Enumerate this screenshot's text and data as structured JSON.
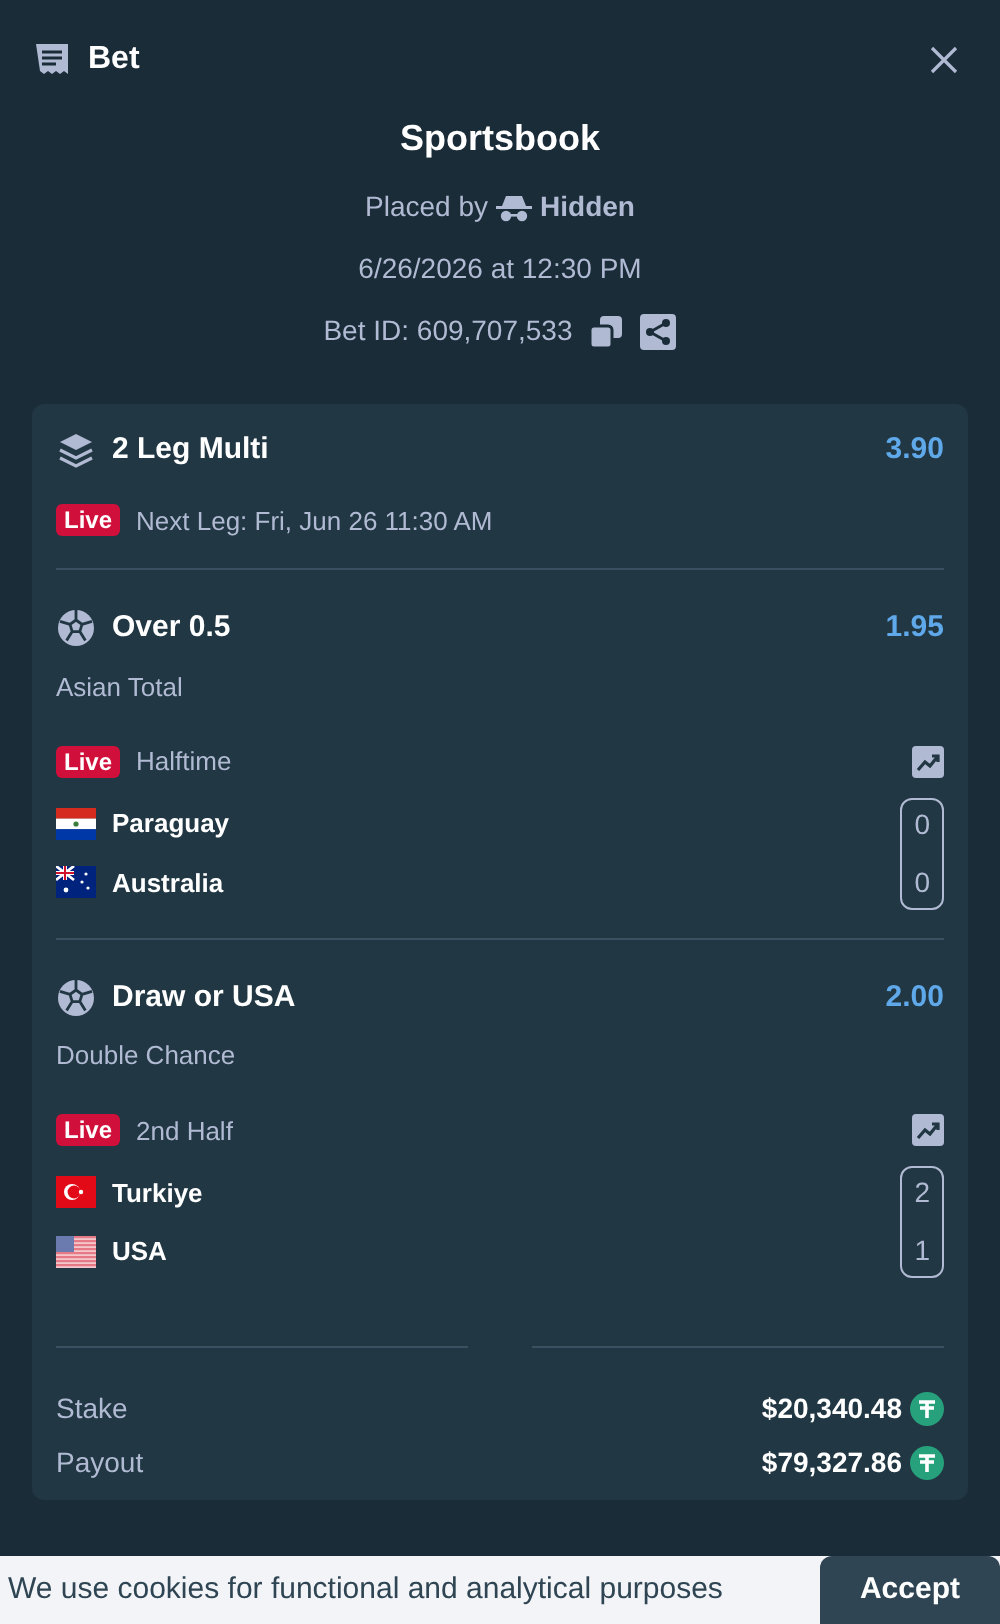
{
  "header": {
    "title": "Bet"
  },
  "summary": {
    "title": "Sportsbook",
    "placed_by": "Placed by",
    "user": "Hidden",
    "date": "6/26/2026 at 12:30 PM",
    "bet_id": "Bet ID: 609,707,533"
  },
  "multi": {
    "title": "2 Leg Multi",
    "odds": "3.90",
    "live_badge": "Live",
    "next_leg": "Next Leg: Fri, Jun 26 11:30 AM"
  },
  "legs": [
    {
      "title": "Over 0.5",
      "odds": "1.95",
      "market": "Asian Total",
      "live_badge": "Live",
      "status": "Halftime",
      "teams": [
        {
          "name": "Paraguay",
          "score": "0",
          "kind": "py"
        },
        {
          "name": "Australia",
          "score": "0",
          "kind": "au"
        }
      ]
    },
    {
      "title": "Draw or USA",
      "odds": "2.00",
      "market": "Double Chance",
      "live_badge": "Live",
      "status": "2nd Half",
      "teams": [
        {
          "name": "Turkiye",
          "score": "2",
          "kind": "tr"
        },
        {
          "name": "USA",
          "score": "1",
          "kind": "us"
        }
      ]
    }
  ],
  "totals": [
    {
      "label": "Stake",
      "value": "$20,340.48"
    },
    {
      "label": "Payout",
      "value": "$79,327.86"
    }
  ],
  "cookie": {
    "text": "We use cookies for functional and analytical purposes",
    "button": "Accept"
  }
}
